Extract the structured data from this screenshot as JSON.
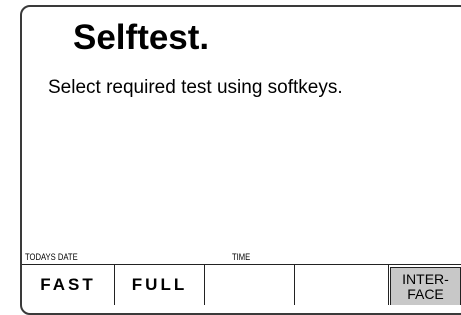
{
  "screen": {
    "title": "Selftest.",
    "instruction": "Select required test using softkeys."
  },
  "status_fields": {
    "date_label": "TODAYS DATE",
    "time_label": "TIME"
  },
  "softkeys": {
    "fast": "FAST",
    "full": "FULL",
    "key3": "",
    "key4": "",
    "interface_line1": "INTER-",
    "interface_line2": "FACE"
  },
  "colors": {
    "background": "#ffffff",
    "frame": "#3a3a3a",
    "highlighted_key": "#c8c8c8"
  }
}
